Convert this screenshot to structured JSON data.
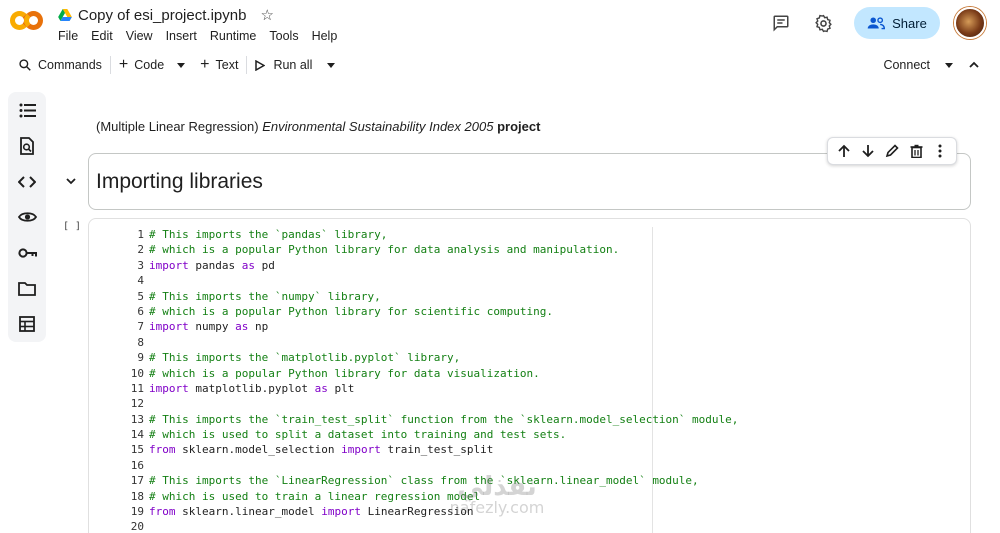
{
  "app": {
    "notebook_title": "Copy of esi_project.ipynb",
    "menu": [
      "File",
      "Edit",
      "View",
      "Insert",
      "Runtime",
      "Tools",
      "Help"
    ],
    "share_label": "Share"
  },
  "toolbar": {
    "commands_label": "Commands",
    "code_label": "Code",
    "text_label": "Text",
    "run_all_label": "Run all",
    "connect_label": "Connect"
  },
  "rail": {
    "icons": [
      "toc-icon",
      "find-replace-icon",
      "code-snippets-icon",
      "variables-icon",
      "secrets-key-icon",
      "files-folder-icon",
      "data-table-icon"
    ]
  },
  "notebook": {
    "markdown_prefix": "(Multiple Linear Regression) ",
    "markdown_italic": "Environmental Sustainability Index 2005",
    "markdown_bold": " project",
    "heading": "Importing libraries",
    "exec_count": "[ ]",
    "code_lines": [
      {
        "n": "1",
        "parts": [
          {
            "t": "# This imports the `pandas` library,",
            "c": "comment"
          }
        ]
      },
      {
        "n": "2",
        "parts": [
          {
            "t": "# which is a popular Python library for data analysis and manipulation.",
            "c": "comment"
          }
        ]
      },
      {
        "n": "3",
        "parts": [
          {
            "t": "import",
            "c": "kw"
          },
          {
            "t": " pandas ",
            "c": "plain"
          },
          {
            "t": "as",
            "c": "kw"
          },
          {
            "t": " pd",
            "c": "plain"
          }
        ]
      },
      {
        "n": "4",
        "parts": []
      },
      {
        "n": "5",
        "parts": [
          {
            "t": "# This imports the `numpy` library,",
            "c": "comment"
          }
        ]
      },
      {
        "n": "6",
        "parts": [
          {
            "t": "# which is a popular Python library for scientific computing.",
            "c": "comment"
          }
        ]
      },
      {
        "n": "7",
        "parts": [
          {
            "t": "import",
            "c": "kw"
          },
          {
            "t": " numpy ",
            "c": "plain"
          },
          {
            "t": "as",
            "c": "kw"
          },
          {
            "t": " np",
            "c": "plain"
          }
        ]
      },
      {
        "n": "8",
        "parts": []
      },
      {
        "n": "9",
        "parts": [
          {
            "t": "# This imports the `matplotlib.pyplot` library,",
            "c": "comment"
          }
        ]
      },
      {
        "n": "10",
        "parts": [
          {
            "t": "# which is a popular Python library for data visualization.",
            "c": "comment"
          }
        ]
      },
      {
        "n": "11",
        "parts": [
          {
            "t": "import",
            "c": "kw"
          },
          {
            "t": " matplotlib.pyplot ",
            "c": "plain"
          },
          {
            "t": "as",
            "c": "kw"
          },
          {
            "t": " plt",
            "c": "plain"
          }
        ]
      },
      {
        "n": "12",
        "parts": []
      },
      {
        "n": "13",
        "parts": [
          {
            "t": "# This imports the `train_test_split` function from the `sklearn.model_selection` module,",
            "c": "comment"
          }
        ]
      },
      {
        "n": "14",
        "parts": [
          {
            "t": "# which is used to split a dataset into training and test sets.",
            "c": "comment"
          }
        ]
      },
      {
        "n": "15",
        "parts": [
          {
            "t": "from",
            "c": "kw"
          },
          {
            "t": " sklearn.model_selection ",
            "c": "plain"
          },
          {
            "t": "import",
            "c": "kw"
          },
          {
            "t": " train_test_split",
            "c": "plain"
          }
        ]
      },
      {
        "n": "16",
        "parts": []
      },
      {
        "n": "17",
        "parts": [
          {
            "t": "# This imports the `LinearRegression` class from the `sklearn.linear_model` module,",
            "c": "comment"
          }
        ]
      },
      {
        "n": "18",
        "parts": [
          {
            "t": "# which is used to train a linear regression model",
            "c": "comment"
          }
        ]
      },
      {
        "n": "19",
        "parts": [
          {
            "t": "from",
            "c": "kw"
          },
          {
            "t": " sklearn.linear_model ",
            "c": "plain"
          },
          {
            "t": "import",
            "c": "kw"
          },
          {
            "t": " LinearRegression",
            "c": "plain"
          }
        ]
      },
      {
        "n": "20",
        "parts": []
      }
    ]
  },
  "watermark": {
    "arabic": "نفذلي",
    "latin": "nafezly.com"
  },
  "colors": {
    "accent": "#0b57d0",
    "share_bg": "#c2e7ff",
    "comment": "#148014",
    "keyword": "#8000c8"
  }
}
